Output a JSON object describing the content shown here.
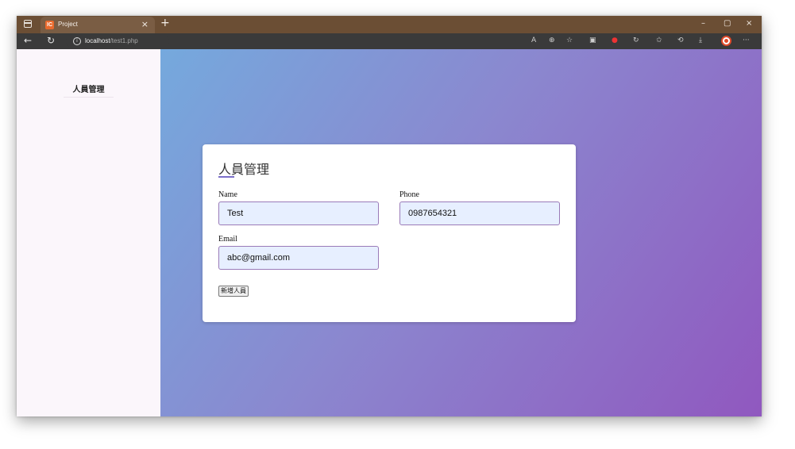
{
  "browser": {
    "tab_title": "Project",
    "tab_close": "×",
    "new_tab": "+",
    "url_host": "localhost",
    "url_path": "/test1.php",
    "window_controls": {
      "minimize": "–",
      "restore": "▢",
      "close": "×"
    },
    "nav": {
      "back": "←",
      "refresh": "↻"
    },
    "toolbar_icons": [
      "read-aloud-icon",
      "zoom-icon",
      "add-favorite-icon",
      "split-screen-icon",
      "extension-icon",
      "copilot-icon",
      "favorites-icon",
      "history-icon",
      "downloads-icon",
      "profile-icon",
      "more-icon"
    ],
    "colors": {
      "titlebar": "#6b4e34",
      "addressbar": "#3a3a3a"
    }
  },
  "sidebar": {
    "title": "人員管理"
  },
  "form": {
    "title": "人員管理",
    "name_label": "Name",
    "name_value": "Test",
    "phone_label": "Phone",
    "phone_value": "0987654321",
    "email_label": "Email",
    "email_value": "abc@gmail.com",
    "submit_label": "新增人員"
  },
  "theme": {
    "gradient_start": "#75a9dd",
    "gradient_end": "#9058bf",
    "input_bg": "#e7efff",
    "accent": "#7b6fc9"
  }
}
